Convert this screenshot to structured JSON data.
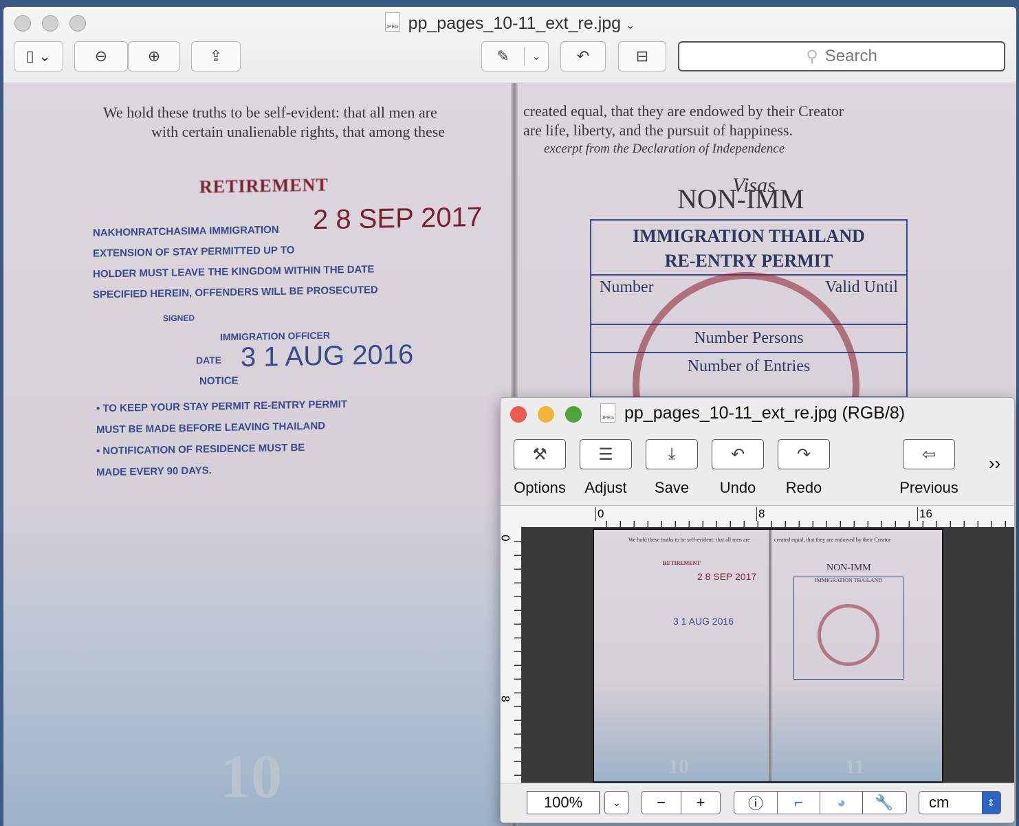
{
  "main_window": {
    "title": "pp_pages_10-11_ext_re.jpg",
    "file_type_badge": "JPEG",
    "search_placeholder": "Search",
    "document": {
      "left_quote_1": "We hold these truths to be self-evident: that all men are",
      "left_quote_2": "with certain unalienable rights, that among these",
      "right_quote_1": "created equal, that they are endowed by their Creator",
      "right_quote_2": "are life, liberty, and the pursuit of happiness.",
      "right_quote_3": "excerpt from the Declaration of Independence",
      "stamp_heading": "RETIREMENT",
      "stamp_lines": [
        "NAKHONRATCHASIMA IMMIGRATION",
        "EXTENSION OF STAY PERMITTED UP TO",
        "HOLDER MUST LEAVE THE KINGDOM WITHIN THE DATE",
        "SPECIFIED HEREIN, OFFENDERS WILL BE PROSECUTED"
      ],
      "stamp_date_1": "2 8 SEP 2017",
      "signed": "SIGNED",
      "officer": "IMMIGRATION OFFICER",
      "date_label": "DATE",
      "stamp_date_2": "3 1 AUG 2016",
      "notice": "NOTICE",
      "notice_lines": [
        "• TO KEEP YOUR STAY PERMIT RE-ENTRY PERMIT",
        "MUST BE MADE BEFORE LEAVING THAILAND",
        "• NOTIFICATION OF RESIDENCE MUST BE",
        "MADE EVERY 90 DAYS."
      ],
      "visas": "Visas",
      "non_imm": "NON-IMM",
      "reentry_1": "IMMIGRATION THAILAND",
      "reentry_2": "RE-ENTRY PERMIT",
      "number": "Number",
      "valid_until": "Valid Until",
      "number_persons": "Number Persons",
      "number_entries": "Number of Entries",
      "page_left": "10",
      "page_right": "11"
    }
  },
  "editor_window": {
    "title": "pp_pages_10-11_ext_re.jpg (RGB/8)",
    "file_type_badge": "JPEG",
    "toolbar": [
      {
        "label": "Options",
        "icon": "options-icon"
      },
      {
        "label": "Adjust",
        "icon": "sliders-icon"
      },
      {
        "label": "Save",
        "icon": "save-icon"
      },
      {
        "label": "Undo",
        "icon": "undo-icon"
      },
      {
        "label": "Redo",
        "icon": "redo-icon"
      },
      {
        "label": "Previous",
        "icon": "previous-icon"
      }
    ],
    "overflow": "››",
    "ruler_top": [
      "0",
      "8",
      "16"
    ],
    "ruler_left": [
      "0",
      "8"
    ],
    "zoom_value": "100%",
    "unit": "cm"
  },
  "colors": {
    "close": "#ee5950",
    "minimize": "#f0b53a",
    "maximize": "#4ca43a",
    "accent": "#2d64c4"
  }
}
